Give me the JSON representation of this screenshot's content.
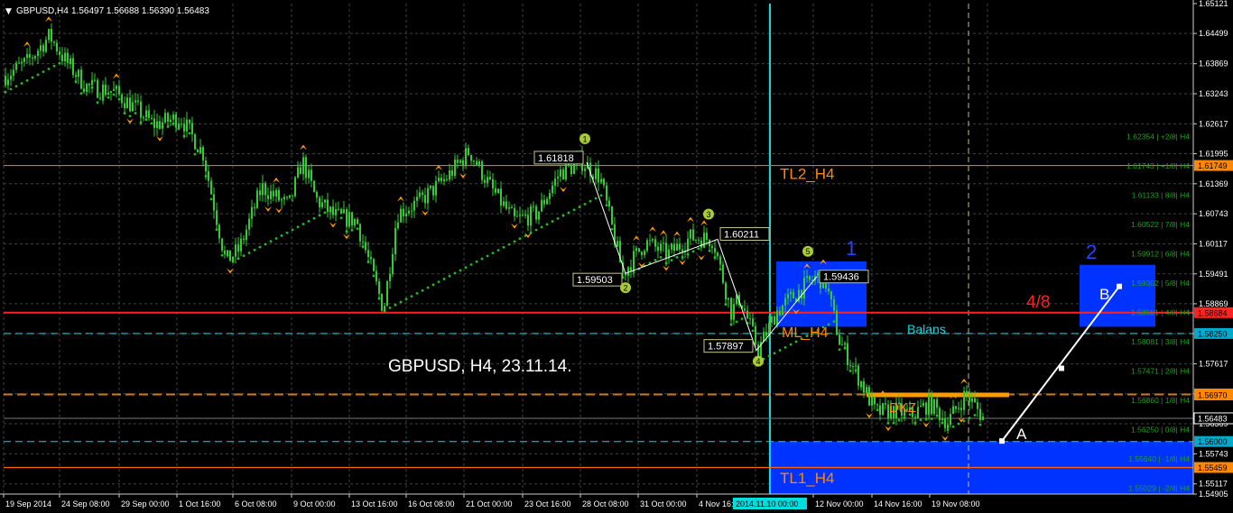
{
  "header": {
    "symbol": "GBPUSD,H4",
    "ohlc": "1.56497 1.56688 1.56390 1.56483"
  },
  "colors": {
    "background": "#000000",
    "grid": "#404040",
    "candle": "#33cc33",
    "dots": "#22bb22",
    "fractal": "#ff9900",
    "orange_line": "#ff6600",
    "red_line": "#ff2222",
    "cyan": "#00dddd",
    "blue_box": "#0033ff",
    "label_orange": "#ff8800",
    "label_blue": "#2244ff",
    "label_red": "#ff2222",
    "white": "#ffffff",
    "murrey_text": "#1f9f1f"
  },
  "annotations": {
    "main_title": "GBPUSD, H4, 23.11.14.",
    "tl2": "TL2_H4",
    "tl1": "TL1_H4",
    "ml": "ML_H4",
    "balans": "Balans",
    "dkz": "DKZ",
    "zone1": "1",
    "zone2": "2",
    "four_eight": "4/8",
    "point_a": "A",
    "point_b": "B",
    "vline_date": "2014.11.10 00:00"
  },
  "chart_data": {
    "type": "candlestick",
    "symbol": "GBPUSD",
    "timeframe": "H4",
    "ylim": [
      1.54905,
      1.65121
    ],
    "y_ticks": [
      "1.65121",
      "1.64499",
      "1.63869",
      "1.63243",
      "1.62617",
      "1.61995",
      "1.61369",
      "1.60743",
      "1.60117",
      "1.59491",
      "1.58869",
      "1.58243",
      "1.57617",
      "1.56995",
      "1.56369",
      "1.55743",
      "1.55117",
      "1.54905"
    ],
    "x_ticks": [
      "19 Sep 2014",
      "24 Sep 08:00",
      "29 Sep 00:00",
      "1 Oct 16:00",
      "6 Oct 08:00",
      "9 Oct 00:00",
      "13 Oct 16:00",
      "16 Oct 08:00",
      "21 Oct 00:00",
      "23 Oct 16:00",
      "28 Oct 08:00",
      "31 Oct 00:00",
      "4 Nov 16:00",
      "12 Nov 00:00",
      "14 Nov 16:00",
      "19 Nov 08:00"
    ],
    "price_path": [
      [
        0,
        1.6355
      ],
      [
        30,
        1.639
      ],
      [
        55,
        1.6445
      ],
      [
        70,
        1.64
      ],
      [
        95,
        1.634
      ],
      [
        125,
        1.633
      ],
      [
        150,
        1.6295
      ],
      [
        170,
        1.626
      ],
      [
        200,
        1.6275
      ],
      [
        225,
        1.62
      ],
      [
        250,
        1.5975
      ],
      [
        265,
        1.6
      ],
      [
        290,
        1.613
      ],
      [
        320,
        1.609
      ],
      [
        335,
        1.6185
      ],
      [
        350,
        1.6105
      ],
      [
        370,
        1.607
      ],
      [
        395,
        1.606
      ],
      [
        425,
        1.5875
      ],
      [
        440,
        1.6075
      ],
      [
        465,
        1.61
      ],
      [
        495,
        1.615
      ],
      [
        520,
        1.6205
      ],
      [
        545,
        1.6125
      ],
      [
        570,
        1.606
      ],
      [
        595,
        1.6075
      ],
      [
        620,
        1.616
      ],
      [
        645,
        1.6182
      ],
      [
        665,
        1.615
      ],
      [
        690,
        1.595
      ],
      [
        715,
        1.6015
      ],
      [
        740,
        1.599
      ],
      [
        765,
        1.6025
      ],
      [
        790,
        1.6021
      ],
      [
        810,
        1.587
      ],
      [
        820,
        1.59
      ],
      [
        840,
        1.579
      ],
      [
        860,
        1.587
      ],
      [
        880,
        1.5905
      ],
      [
        905,
        1.5944
      ],
      [
        915,
        1.593
      ],
      [
        930,
        1.581
      ],
      [
        955,
        1.572
      ],
      [
        970,
        1.566
      ],
      [
        990,
        1.5665
      ],
      [
        1010,
        1.5655
      ],
      [
        1030,
        1.568
      ],
      [
        1050,
        1.564
      ],
      [
        1070,
        1.57
      ],
      [
        1090,
        1.5648
      ]
    ],
    "horizontal_levels": [
      {
        "price": 1.61749,
        "kind": "orange",
        "label": "1.61749"
      },
      {
        "price": 1.58684,
        "kind": "red",
        "label": "1.58684"
      },
      {
        "price": 1.5825,
        "kind": "cyan",
        "label": "1.58250"
      },
      {
        "price": 1.5699,
        "kind": "orange_dashed",
        "label": "1.56990"
      },
      {
        "price": 1.5697,
        "kind": "orange_dashed",
        "label": "1.56970"
      },
      {
        "price": 1.56483,
        "kind": "current",
        "label": "1.56483"
      },
      {
        "price": 1.56,
        "kind": "cyan",
        "label": "1.56000"
      },
      {
        "price": 1.55459,
        "kind": "orange",
        "label": "1.55459"
      }
    ],
    "murrey_levels": [
      {
        "price": 1.62354,
        "label": "1.62354 | +2/8| H4"
      },
      {
        "price": 1.61743,
        "label": "1.61743 | +1/8| H4"
      },
      {
        "price": 1.61133,
        "label": "1.61133 | 8/8| H4"
      },
      {
        "price": 1.60522,
        "label": "1.60522 | 7/8| H4"
      },
      {
        "price": 1.59912,
        "label": "1.59912 | 6/8| H4"
      },
      {
        "price": 1.59302,
        "label": "1.59302 | 5/8| H4"
      },
      {
        "price": 1.58691,
        "label": "1.58691 | 4/8| H4"
      },
      {
        "price": 1.58081,
        "label": "1.58081 | 3/8| H4"
      },
      {
        "price": 1.57471,
        "label": "1.57471 | 2/8| H4"
      },
      {
        "price": 1.5686,
        "label": "1.56860 | 1/8| H4"
      },
      {
        "price": 1.5625,
        "label": "1.56250 | 0/8| H4"
      },
      {
        "price": 1.5564,
        "label": "1.55640 | -1/8| H4"
      },
      {
        "price": 1.55029,
        "label": "1.55029 | -2/8| H4"
      }
    ],
    "wave_points": [
      {
        "label": "1.61818",
        "num": "1",
        "price": 1.61818
      },
      {
        "label": "1.59503",
        "num": "2",
        "price": 1.59503
      },
      {
        "label": "1.60211",
        "num": "3",
        "price": 1.60211
      },
      {
        "label": "1.57897",
        "num": "4",
        "price": 1.57897
      },
      {
        "label": "1.59436",
        "num": "5",
        "price": 1.59436
      }
    ],
    "boxes": [
      {
        "name": "zone-1",
        "price_top": 1.5975,
        "price_bottom": 1.5839
      },
      {
        "name": "zone-2",
        "price_top": 1.5968,
        "price_bottom": 1.5839
      },
      {
        "name": "zone-bottom",
        "price_top": 1.56,
        "price_bottom": 1.54905
      }
    ],
    "projection_line": {
      "from_price": 1.5601,
      "to_price": 1.5923,
      "mid_price": 1.57525
    }
  }
}
